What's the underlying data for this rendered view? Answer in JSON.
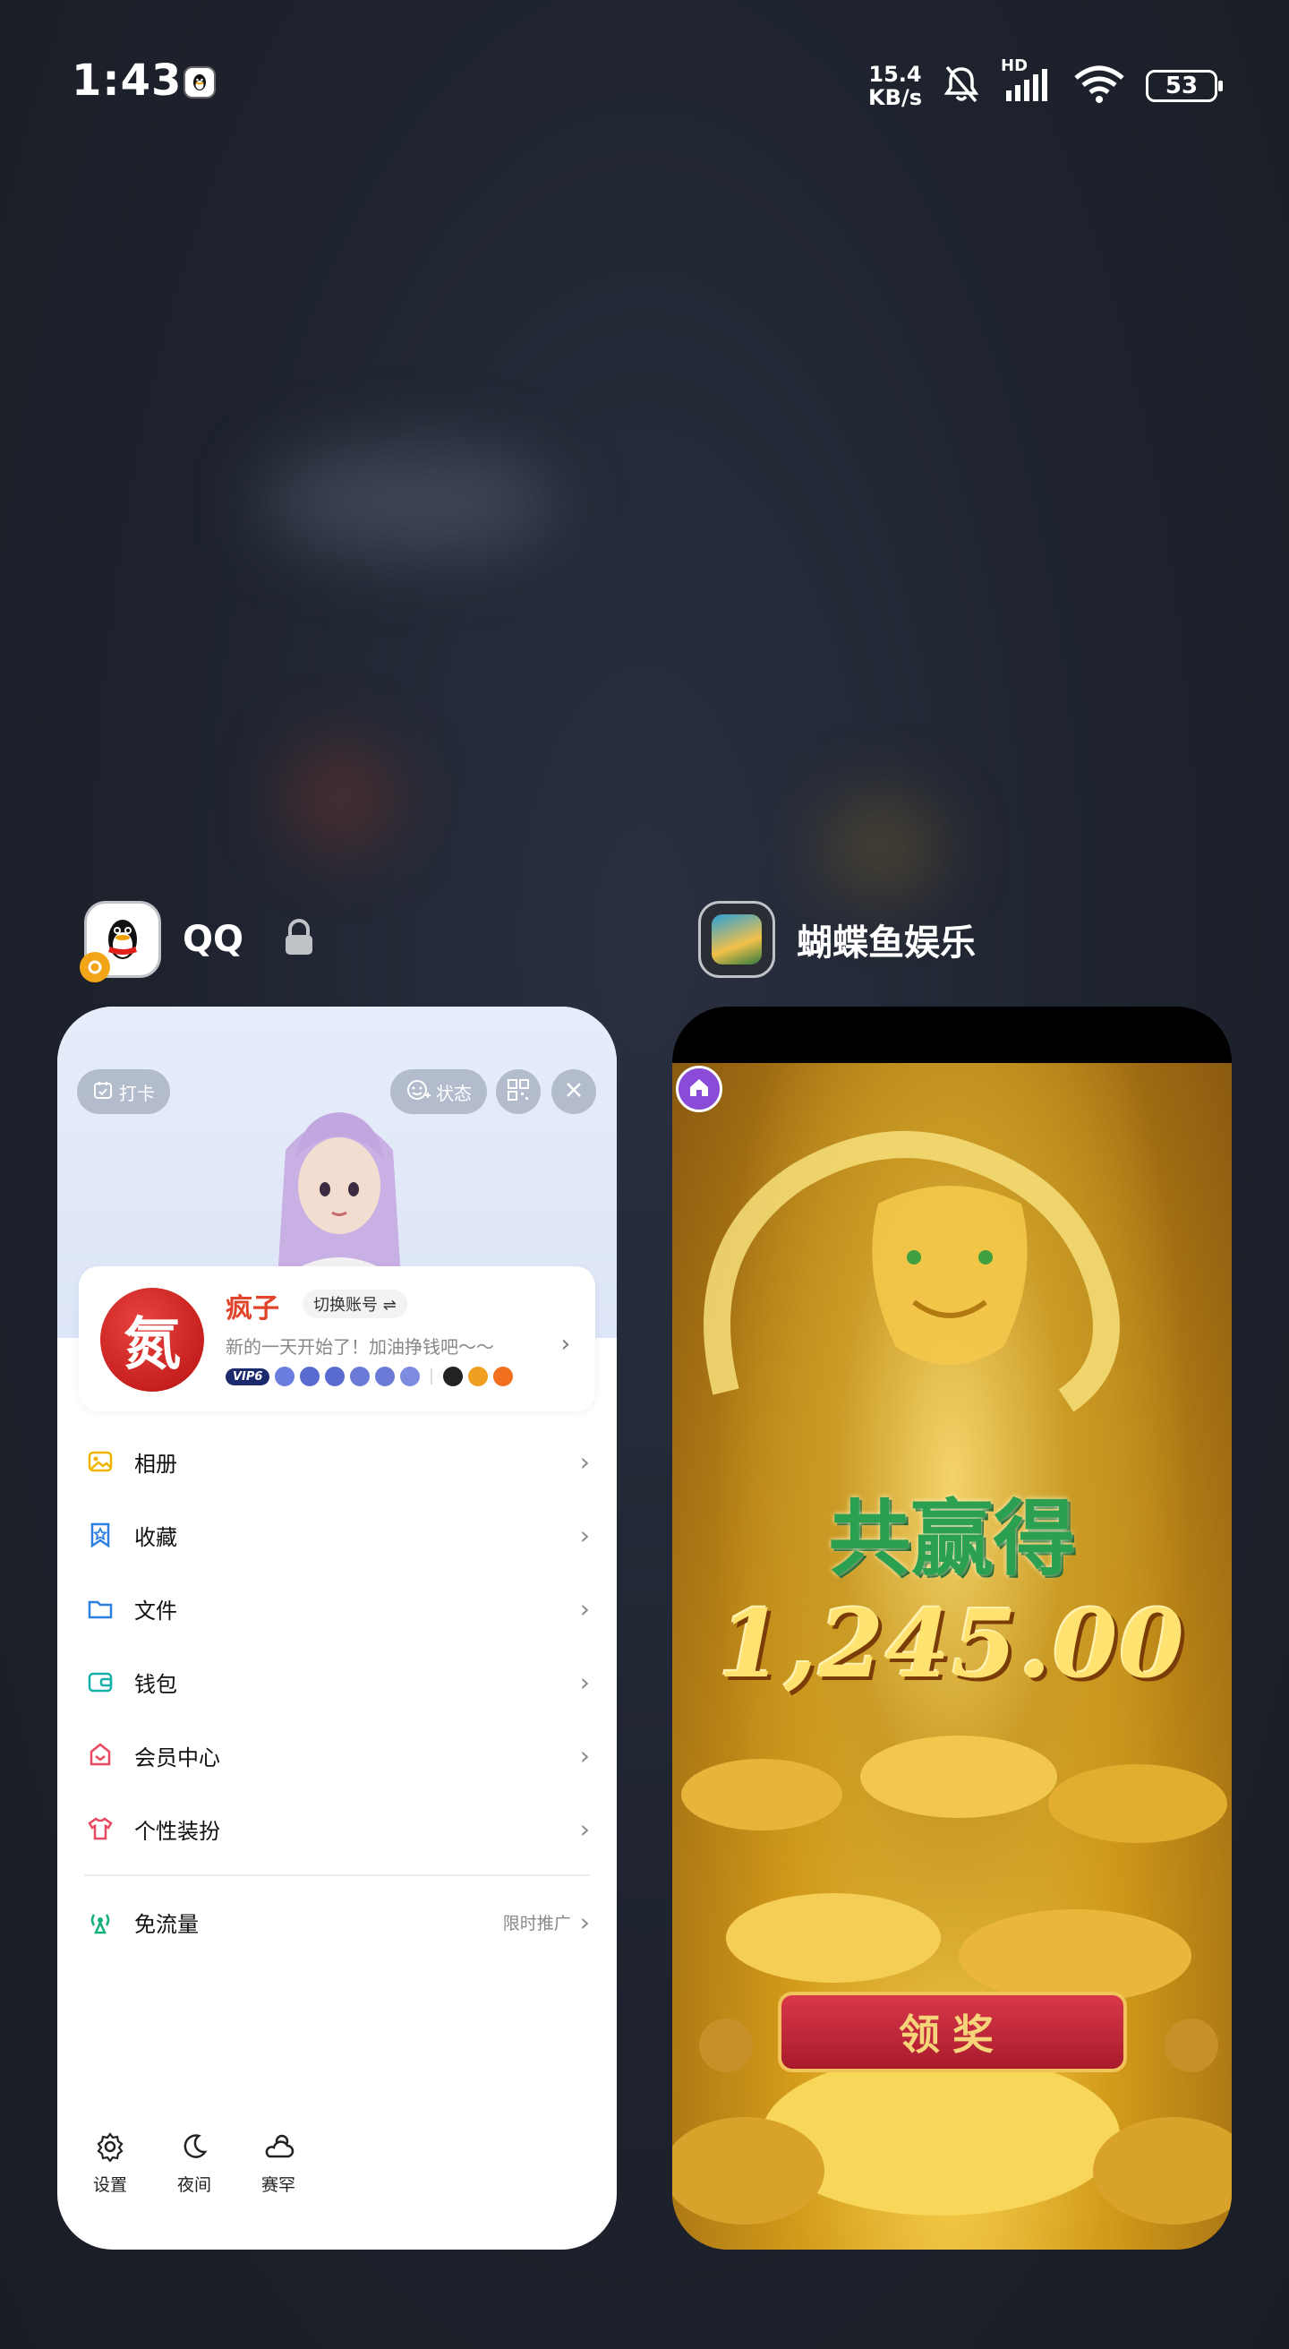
{
  "status_bar": {
    "time": "1:43",
    "net_speed_value": "15.4",
    "net_speed_unit": "KB/s",
    "network_type": "HD",
    "battery": "53"
  },
  "apps": [
    {
      "name": "QQ",
      "locked": true
    },
    {
      "name": "蝴蝶鱼娱乐"
    }
  ],
  "qq": {
    "checkin_label": "打卡",
    "status_label": "状态",
    "profile": {
      "avatar_char": "氮",
      "name": "疯子",
      "switch_label": "切换账号 ⇌",
      "signature": "新的一天开始了！加油挣钱吧～～",
      "vip_badge": "VIP6"
    },
    "menu": [
      {
        "label": "相册",
        "icon": "album-icon",
        "color": "#f0b400"
      },
      {
        "label": "收藏",
        "icon": "favorites-icon",
        "color": "#2b7fe0"
      },
      {
        "label": "文件",
        "icon": "folder-icon",
        "color": "#2b7fe0"
      },
      {
        "label": "钱包",
        "icon": "wallet-icon",
        "color": "#13b0a8"
      },
      {
        "label": "会员中心",
        "icon": "vip-center-icon",
        "color": "#e84a5f"
      },
      {
        "label": "个性装扮",
        "icon": "shirt-icon",
        "color": "#e84a5f"
      }
    ],
    "free_data": {
      "label": "免流量",
      "extra": "限时推广"
    },
    "bottom": [
      {
        "label": "设置",
        "icon": "gear-icon"
      },
      {
        "label": "夜间",
        "icon": "moon-icon"
      },
      {
        "label": "赛罕",
        "icon": "weather-icon"
      }
    ]
  },
  "game": {
    "win_title": "共赢得",
    "win_amount": "1,245.00",
    "claim_button": "领奖"
  }
}
